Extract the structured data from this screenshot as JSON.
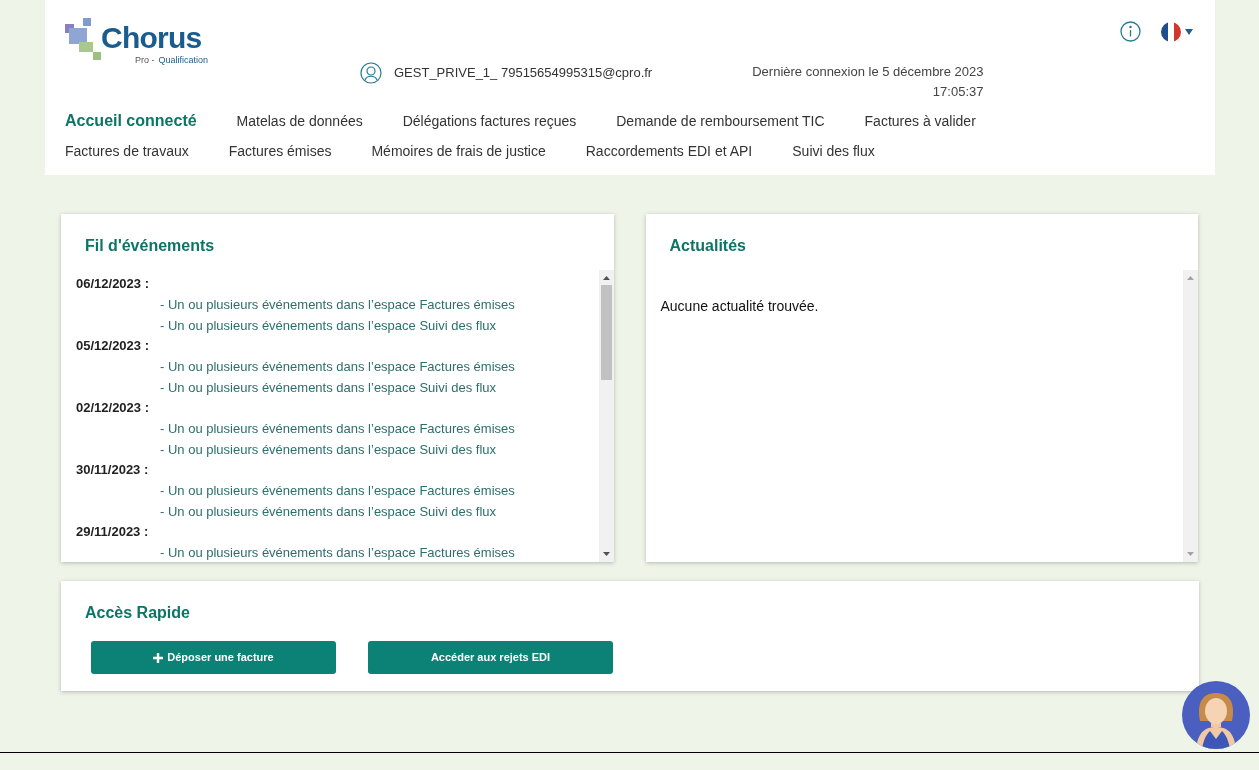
{
  "header": {
    "logo": {
      "name": "Chorus",
      "sub_prefix": "Pro -",
      "sub": "Qualification"
    },
    "user": "GEST_PRIVE_1_ 79515654995315@cpro.fr",
    "last_login": "Dernière connexion le 5 décembre 2023",
    "last_login_time": "17:05:37"
  },
  "nav": [
    [
      {
        "label": "Accueil connecté",
        "selected": true
      },
      {
        "label": "Matelas de données",
        "selected": false
      },
      {
        "label": "Délégations factures reçues",
        "selected": false
      },
      {
        "label": "Demande de remboursement TIC",
        "selected": false
      },
      {
        "label": "Factures à valider",
        "selected": false
      }
    ],
    [
      {
        "label": "Factures de travaux",
        "selected": false
      },
      {
        "label": "Factures émises",
        "selected": false
      },
      {
        "label": "Mémoires de frais de justice",
        "selected": false
      },
      {
        "label": "Raccordements EDI et API",
        "selected": false
      },
      {
        "label": "Suivi des flux",
        "selected": false
      }
    ]
  ],
  "events": {
    "title": "Fil d'événements",
    "groups": [
      {
        "date": "06/12/2023 :",
        "items": [
          "- Un ou plusieurs événements dans l’espace Factures émises",
          "- Un ou plusieurs événements dans l’espace Suivi des flux"
        ]
      },
      {
        "date": "05/12/2023 :",
        "items": [
          "- Un ou plusieurs événements dans l’espace Factures émises",
          "- Un ou plusieurs événements dans l’espace Suivi des flux"
        ]
      },
      {
        "date": "02/12/2023 :",
        "items": [
          "- Un ou plusieurs événements dans l’espace Factures émises",
          "- Un ou plusieurs événements dans l’espace Suivi des flux"
        ]
      },
      {
        "date": "30/11/2023 :",
        "items": [
          "- Un ou plusieurs événements dans l’espace Factures émises",
          "- Un ou plusieurs événements dans l’espace Suivi des flux"
        ]
      },
      {
        "date": "29/11/2023 :",
        "items": [
          "- Un ou plusieurs événements dans l’espace Factures émises"
        ]
      }
    ]
  },
  "news": {
    "title": "Actualités",
    "empty": "Aucune actualité trouvée."
  },
  "quick_access": {
    "title": "Accès Rapide",
    "buttons": [
      {
        "label": "Déposer une facture",
        "kind": "add"
      },
      {
        "label": "Accéder aux rejets EDI",
        "kind": "plain"
      }
    ]
  }
}
